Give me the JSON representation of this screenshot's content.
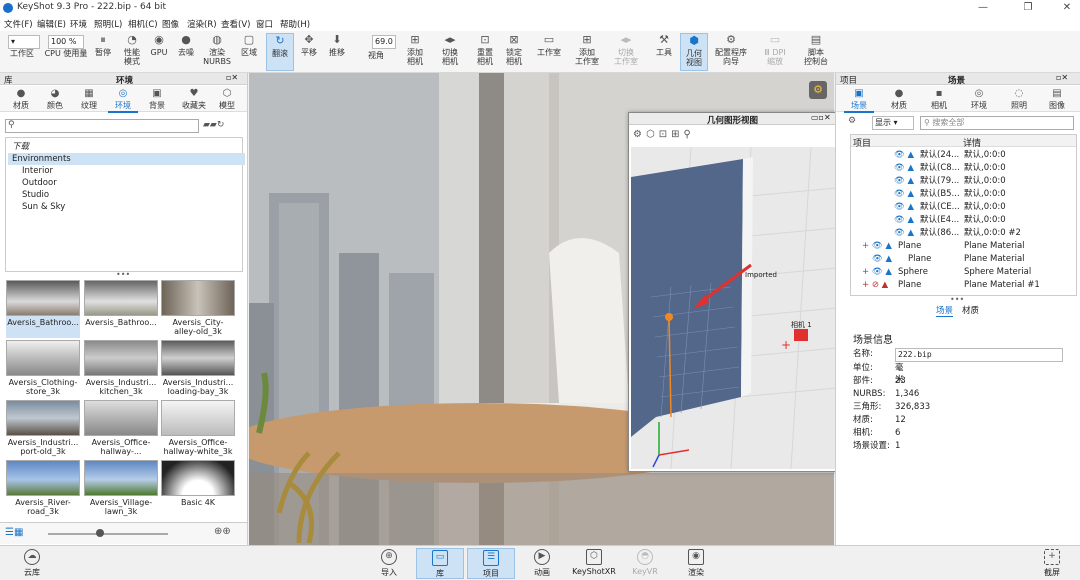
{
  "window": {
    "title": "KeyShot 9.3 Pro  - 222.bip  - 64 bit",
    "min": "—",
    "max": "❐",
    "close": "✕"
  },
  "menu": [
    "文件(F)",
    "编辑(E)",
    "环境",
    "照明(L)",
    "相机(C)",
    "图像",
    "渲染(R)",
    "查看(V)",
    "窗口",
    "帮助(H)"
  ],
  "toolbar": {
    "zoom": "100 %",
    "angle": "69.0",
    "buttons": [
      "工作区",
      "CPU 使用量",
      "暂停",
      "性能模式",
      "GPU",
      "去噪",
      "渲染NURBS",
      "区域",
      "翻滚",
      "平移",
      "推移",
      "视角",
      "添加相机",
      "切换相机",
      "重置相机",
      "锁定相机",
      "工作室",
      "添加工作室",
      "切换工作室",
      "工具",
      "几何视图",
      "配置程序向导",
      "KeyShotXR",
      "脚本控制台"
    ],
    "labels": {
      "workspace": "工作区",
      "cpu": "CPU 使用量",
      "pause": "暂停",
      "perf1": "性能",
      "perf2": "模式",
      "gpu": "GPU",
      "denoise": "去噪",
      "nurbs1": "渲染",
      "nurbs2": "NURBS",
      "region": "区域",
      "tumble": "翻滚",
      "pan": "平移",
      "dolly": "推移",
      "view": "视角",
      "addcam1": "添加",
      "addcam2": "相机",
      "switch1": "切换",
      "switch2": "相机",
      "reset1": "重置",
      "reset2": "相机",
      "lock1": "锁定",
      "lock2": "相机",
      "studio": "工作室",
      "addst1": "添加",
      "addst2": "工作室",
      "swst1": "切换",
      "swst2": "工作室",
      "tools": "工具",
      "geo1": "几何",
      "geo2": "视图",
      "cfg1": "配置程序",
      "cfg2": "向导",
      "vr1": "Ⅲ DPI",
      "vr2": "缩放",
      "script1": "脚本",
      "script2": "控制台"
    }
  },
  "library": {
    "header": "库",
    "subheader": "环境",
    "tabs": [
      "材质",
      "颜色",
      "纹理",
      "环境",
      "背景",
      "收藏夹",
      "模型"
    ],
    "tree": [
      "下载",
      "Environments",
      "Interior",
      "Outdoor",
      "Studio",
      "Sun & Sky"
    ],
    "thumbs": [
      [
        "Aversis_Bathroo...",
        ""
      ],
      [
        "Aversis_Bathroo...",
        ""
      ],
      [
        "Aversis_City-",
        "alley-old_3k"
      ],
      [
        "Aversis_Clothing-",
        "store_3k"
      ],
      [
        "Aversis_Industri...",
        "kitchen_3k"
      ],
      [
        "Aversis_Industri...",
        "loading-bay_3k"
      ],
      [
        "Aversis_Industri...",
        "port-old_3k"
      ],
      [
        "Aversis_Office-",
        "hallway-..."
      ],
      [
        "Aversis_Office-",
        "hallway-white_3k"
      ],
      [
        "Aversis_River-",
        "road_3k"
      ],
      [
        "Aversis_Village-",
        "lawn_3k"
      ],
      [
        "Basic 4K",
        ""
      ]
    ]
  },
  "geometry": {
    "title": "几何图形视图",
    "cam_label": "Imported",
    "cam2": "相机 1"
  },
  "scene": {
    "header_left": "项目",
    "header": "场景",
    "tabs": [
      "场景",
      "材质",
      "相机",
      "环境",
      "照明",
      "图像"
    ],
    "filter": "显示",
    "search": "搜索全部",
    "cols": [
      "项目",
      "详情"
    ],
    "rows": [
      [
        "默认(24...",
        "默认,0:0:0"
      ],
      [
        "默认(C8...",
        "默认,0:0:0"
      ],
      [
        "默认(79...",
        "默认,0:0:0"
      ],
      [
        "默认(B5...",
        "默认,0:0:0"
      ],
      [
        "默认(CE...",
        "默认,0:0:0"
      ],
      [
        "默认(E4...",
        "默认,0:0:0"
      ],
      [
        "默认(86...",
        "默认,0:0:0 #2"
      ],
      [
        "Plane",
        "Plane Material"
      ],
      [
        "Plane",
        "Plane Material"
      ],
      [
        "Sphere",
        "Sphere Material"
      ],
      [
        "Plane",
        "Plane Material #1"
      ]
    ],
    "subtabs": [
      "场景",
      "材质"
    ],
    "info_title": "场景信息",
    "info": [
      [
        "名称:",
        "222.bip"
      ],
      [
        "单位:",
        "毫米"
      ],
      [
        "部件:",
        "23"
      ],
      [
        "NURBS:",
        "1,346"
      ],
      [
        "三角形:",
        "326,833"
      ],
      [
        "材质:",
        "12"
      ],
      [
        "相机:",
        "6"
      ],
      [
        "场景设置:",
        "1"
      ]
    ]
  },
  "bottom": {
    "left": "云库",
    "buttons": [
      "导入",
      "库",
      "项目",
      "动画",
      "KeyShotXR",
      "KeyVR",
      "渲染"
    ],
    "right": "截屏"
  }
}
